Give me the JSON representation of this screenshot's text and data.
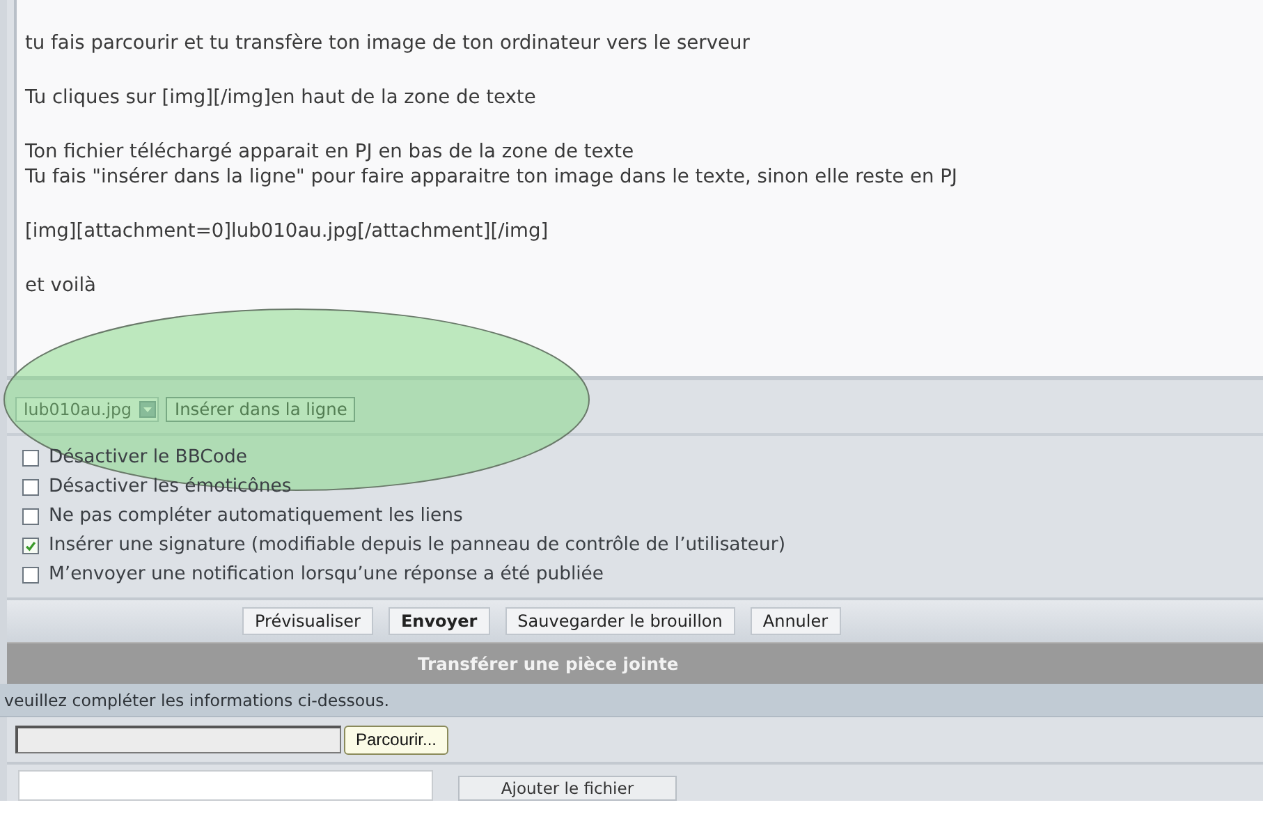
{
  "message": {
    "paragraphs": [
      [
        "tu fais parcourir et tu transfère ton image de ton ordinateur vers le serveur"
      ],
      [
        "Tu cliques sur [img][/img]en haut de la zone de texte"
      ],
      [
        "Ton fichier téléchargé apparait en PJ en bas de la zone de texte",
        "Tu fais \"insérer dans la ligne\" pour faire apparaitre ton image dans le texte, sinon elle reste en PJ"
      ],
      [
        "[img][attachment=0]lub010au.jpg[/attachment][/img]"
      ],
      [
        "et voilà"
      ]
    ]
  },
  "attachment": {
    "file": "lub010au.jpg",
    "insert_button": "Insérer dans la ligne"
  },
  "options": [
    {
      "label": "Désactiver le BBCode",
      "checked": false
    },
    {
      "label": "Désactiver les émoticônes",
      "checked": false
    },
    {
      "label": "Ne pas compléter automatiquement les liens",
      "checked": false
    },
    {
      "label": "Insérer une signature (modifiable depuis le panneau de contrôle de l’utilisateur)",
      "checked": true
    },
    {
      "label": "M’envoyer une notification lorsqu’une réponse a été publiée",
      "checked": false
    }
  ],
  "actions": [
    {
      "label": "Prévisualiser",
      "kind": "default"
    },
    {
      "label": "Envoyer",
      "kind": "primary"
    },
    {
      "label": "Sauvegarder le brouillon",
      "kind": "default"
    },
    {
      "label": "Annuler",
      "kind": "default"
    }
  ],
  "upload": {
    "title": "Transférer une pièce jointe",
    "instruction": "veuillez compléter les informations ci-dessous.",
    "browse_button": "Parcourir...",
    "add_button": "Ajouter le fichier"
  }
}
